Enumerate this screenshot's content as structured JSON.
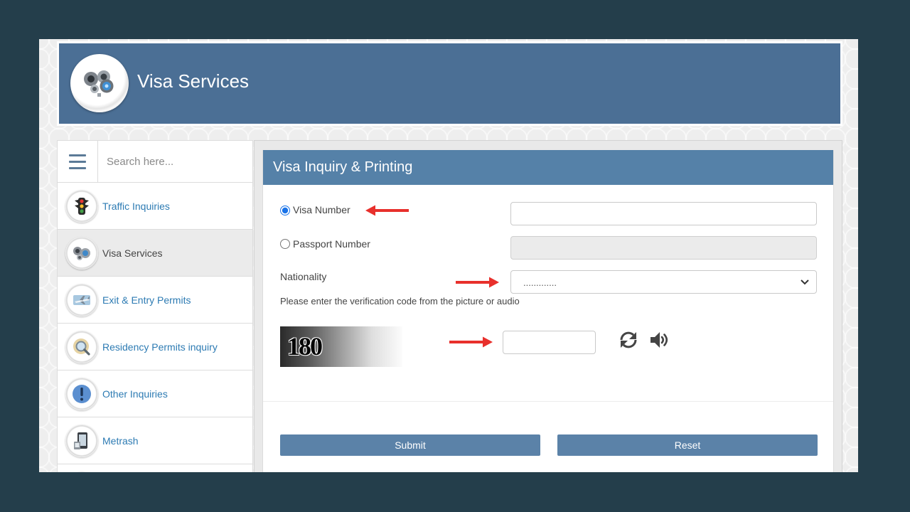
{
  "colors": {
    "page_bg": "#243e4b",
    "header_bg": "#4b6f95",
    "panel_title_bg": "#5581a8",
    "button_bg": "#5b82a8",
    "link": "#2d7bb3",
    "annotation_arrow": "#e8302c"
  },
  "header": {
    "title": "Visa Services",
    "logo_icon": "visa-services-logo"
  },
  "sidebar": {
    "menu_icon": "hamburger-menu-icon",
    "search": {
      "placeholder": "Search here...",
      "value": ""
    },
    "items": [
      {
        "label": "Traffic Inquiries",
        "icon": "traffic-light-icon",
        "active": false
      },
      {
        "label": "Visa Services",
        "icon": "visa-services-icon",
        "active": true
      },
      {
        "label": "Exit & Entry Permits",
        "icon": "airplane-icon",
        "active": false
      },
      {
        "label": "Residency Permits inquiry",
        "icon": "residency-magnifier-icon",
        "active": false
      },
      {
        "label": "Other Inquiries",
        "icon": "exclamation-icon",
        "active": false
      },
      {
        "label": "Metrash",
        "icon": "mobile-device-icon",
        "active": false
      }
    ]
  },
  "form": {
    "title": "Visa Inquiry & Printing",
    "visa_number": {
      "label": "Visa Number",
      "value": "",
      "checked": true
    },
    "passport_number": {
      "label": "Passport Number",
      "value": "",
      "checked": false,
      "disabled": true
    },
    "nationality": {
      "label": "Nationality",
      "selected": "............."
    },
    "verification": {
      "hint": "Please enter the verification code from the picture or audio",
      "captcha_text": "180",
      "value": "",
      "refresh_icon": "refresh-icon",
      "audio_icon": "speaker-icon"
    },
    "buttons": {
      "submit": "Submit",
      "reset": "Reset"
    }
  }
}
